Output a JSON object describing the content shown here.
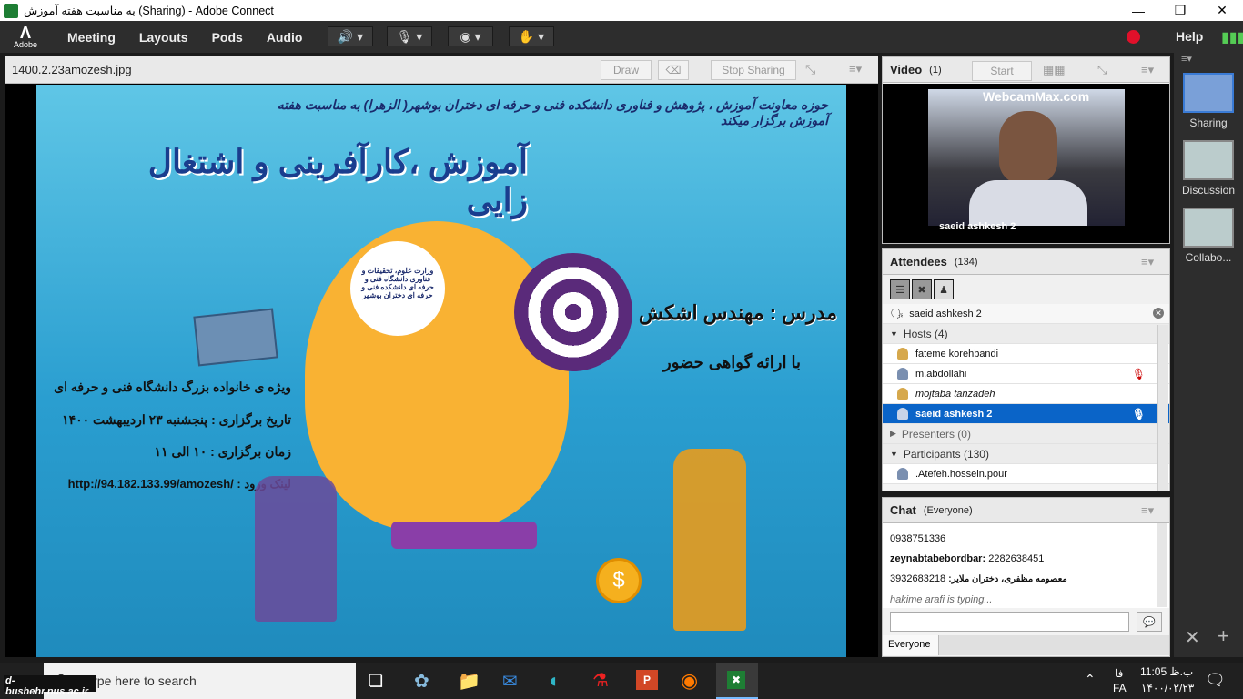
{
  "window": {
    "title": "به مناسبت هفته آموزش (Sharing) - Adobe Connect"
  },
  "menubar": {
    "logo": "Adobe",
    "items": [
      "Meeting",
      "Layouts",
      "Pods",
      "Audio"
    ],
    "help": "Help"
  },
  "share_pod": {
    "filename": "1400.2.23amozesh.jpg",
    "draw_label": "Draw",
    "stop_sharing_label": "Stop Sharing",
    "slide": {
      "header": "حوزه معاونت آموزش ، پژوهش و فناوری دانشکده فنی و حرفه ای دختران بوشهر( الزهرا) به مناسبت هفته آموزش برگزار میکند",
      "title": "آموزش ،کارآفرینی و اشتغال زایی",
      "teacher": "مدرس : مهندس اشکش",
      "certificate": "با ارائه گواهی حضور",
      "audience": "ویژه ی خانواده بزرگ دانشگاه فنی و حرفه ای",
      "date": "تاریخ برگزاری : پنجشنبه ۲۳ اردیبهشت ۱۴۰۰",
      "time": "زمان برگزاری : ۱۰ الی ۱۱",
      "link": "http://94.182.133.99/amozesh/ : لینک ورود",
      "logo_text": "وزارت علوم، تحقیقات و فناوری دانشگاه فنی و حرفه ای دانشکده فنی و حرفه ای دختران بوشهر"
    }
  },
  "video_pod": {
    "title": "Video",
    "count": "(1)",
    "start_label": "Start",
    "caption": "saeid ashkesh 2",
    "watermark": "WebcamMax.com"
  },
  "attendees_pod": {
    "title": "Attendees",
    "count": "(134)",
    "active_speaker": "saeid ashkesh 2",
    "hosts_label": "Hosts (4)",
    "hosts": [
      "fateme korehbandi",
      "m.abdollahi",
      "mojtaba tanzadeh",
      "saeid ashkesh 2"
    ],
    "presenters_label": "Presenters (0)",
    "participants_label": "Participants (130)",
    "participants": [
      ".Atefeh.hossein.pour"
    ]
  },
  "chat_pod": {
    "title": "Chat",
    "scope": "(Everyone)",
    "messages": [
      {
        "sender": "",
        "text": "0938751336"
      },
      {
        "sender": "zeynabtabebordbar:",
        "text": "2282638451"
      },
      {
        "sender": "معصومه مظفری، دختران ملایر:",
        "text": "3932683218"
      }
    ],
    "typing": "hakime arafi is typing...",
    "tab_label": "Everyone"
  },
  "layouts": {
    "items": [
      "Sharing",
      "Discussion",
      "Collabo..."
    ]
  },
  "taskbar": {
    "search_placeholder": "Type here to search",
    "overlay_text": "d-bushehr.nus.ac.ir",
    "lang": "FA",
    "lang2": "فا",
    "time": "11:05 ب.ظ",
    "date": "۱۴۰۰/۰۲/۲۳"
  },
  "colors": {
    "accent": "#0a64c8",
    "record": "#e0102a",
    "menubar": "#2d2d2d"
  }
}
